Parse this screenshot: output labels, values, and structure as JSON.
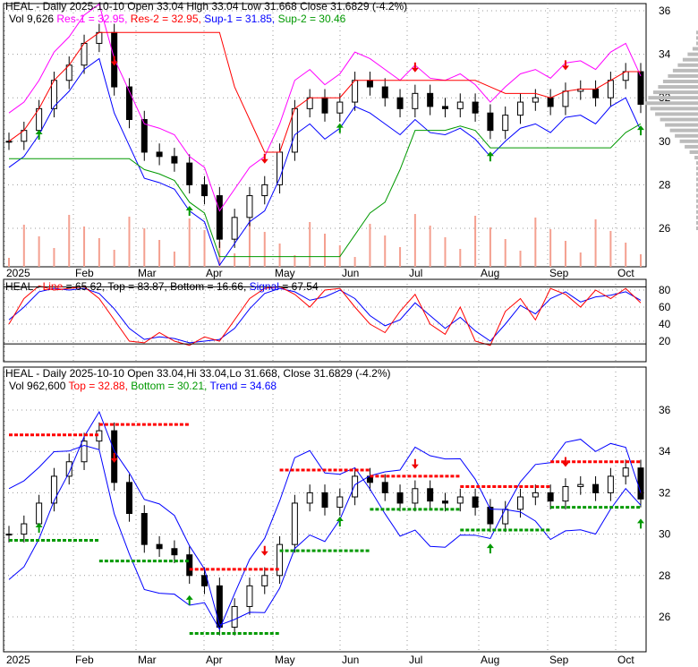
{
  "panel1": {
    "title": "HEAL - Daily 2025-10-10 Open 33.04  High 33.04  Low 31.668  Close 31.6829 (-4.2%)",
    "vol": "Vol 9,626",
    "res1": "Res-1 = 32.95,",
    "res2": "Res-2 = 32.95,",
    "sup1": "Sup-1 = 31.85,",
    "sup2": "Sup-2 = 30.46"
  },
  "panel2": {
    "prefix": "HEAL - ",
    "line": "Line",
    "line_val": "= 65.62, Top = 83.87, Bottom = 16.66,",
    "signal": "Signal",
    "signal_val": "= 67.54"
  },
  "panel3": {
    "title": "HEAL - Daily 2025-10-10 Open 33.04,Hi 33.04,Lo 31.668, Close 31.6829 (-4.2%)",
    "vol": "Vol 962,600",
    "top": "Top = 32.88,",
    "bottom": "Bottom = 30.21,",
    "trend": "Trend = 34.68"
  },
  "colors": {
    "res1": "#ff00ff",
    "res2": "#ff0000",
    "sup1": "#0000ff",
    "sup2": "#009900",
    "up": "#008800",
    "down": "#ff0000"
  },
  "chart_data": {
    "type": "line",
    "months": [
      "2025",
      "Feb",
      "Mar",
      "Apr",
      "May",
      "Jun",
      "Jul",
      "Aug",
      "Sep",
      "Oct"
    ],
    "price_ticks": [
      36,
      34,
      32,
      30,
      28,
      26
    ],
    "osc_ticks": [
      80,
      60,
      40,
      20
    ],
    "weekly_close": [
      30.0,
      30.5,
      31.5,
      32.8,
      33.5,
      34.5,
      35.0,
      32.5,
      31.0,
      29.5,
      29.3,
      29.0,
      28.0,
      27.5,
      25.5,
      26.5,
      27.5,
      28.0,
      29.5,
      31.5,
      32.0,
      31.3,
      31.8,
      32.8,
      32.5,
      32.0,
      31.5,
      32.2,
      31.6,
      31.5,
      31.8,
      31.3,
      30.5,
      31.2,
      31.8,
      32.0,
      31.6,
      32.3,
      32.4,
      32.0,
      32.8,
      33.2,
      31.7
    ],
    "osc_line": [
      40,
      70,
      85,
      80,
      82,
      84,
      70,
      45,
      20,
      18,
      30,
      20,
      15,
      25,
      20,
      45,
      70,
      82,
      84,
      75,
      60,
      80,
      82,
      60,
      40,
      30,
      55,
      75,
      40,
      28,
      60,
      20,
      15,
      55,
      70,
      45,
      82,
      75,
      60,
      80,
      70,
      82,
      65
    ],
    "osc_signal": [
      45,
      60,
      78,
      82,
      80,
      82,
      76,
      58,
      35,
      22,
      25,
      23,
      18,
      20,
      22,
      35,
      58,
      76,
      82,
      78,
      68,
      72,
      80,
      70,
      50,
      38,
      45,
      65,
      50,
      35,
      48,
      32,
      20,
      40,
      62,
      52,
      70,
      78,
      66,
      72,
      74,
      78,
      68
    ]
  }
}
